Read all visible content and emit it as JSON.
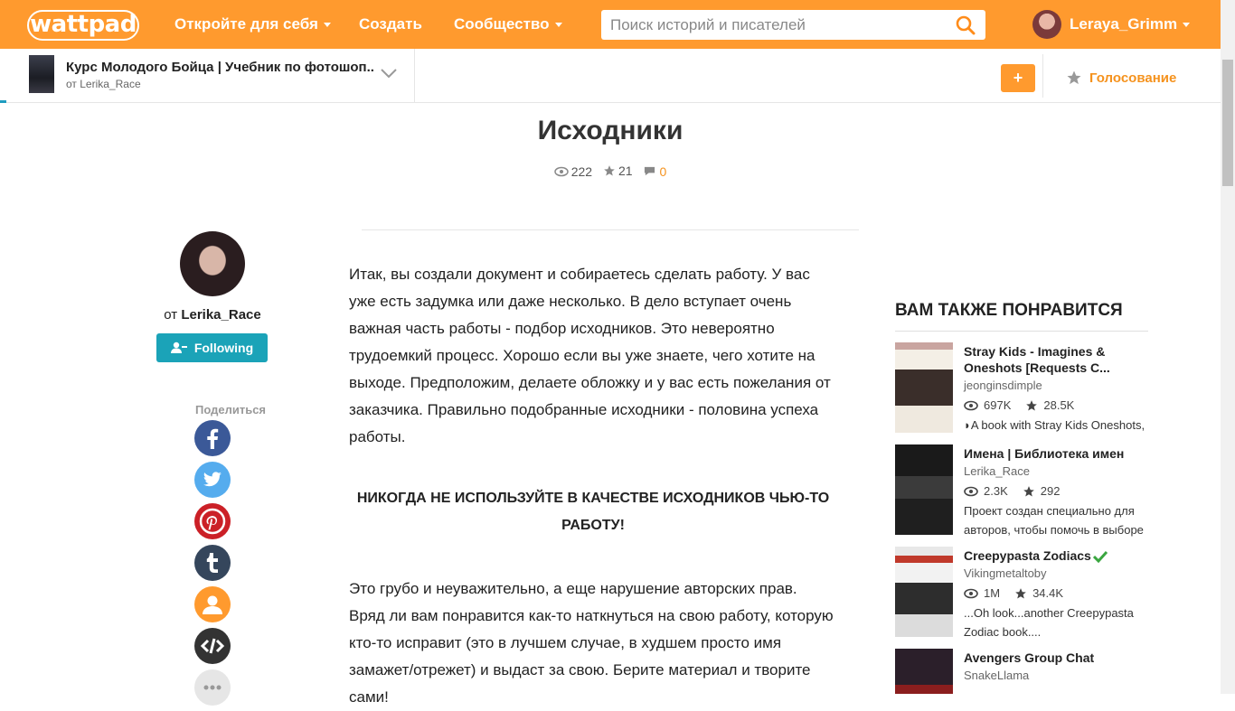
{
  "header": {
    "logo": "wattpad",
    "nav": [
      {
        "label": "Откройте для себя",
        "dropdown": true
      },
      {
        "label": "Создать",
        "dropdown": false
      },
      {
        "label": "Сообщество",
        "dropdown": true
      }
    ],
    "search_placeholder": "Поиск историй и писателей",
    "username": "Leraya_Grimm"
  },
  "storybar": {
    "title": "Курс Молодого Бойца | Учебник по фотошоп...",
    "author": "от Lerika_Race",
    "add_label": "+",
    "vote_label": "Голосование",
    "read_progress": 0.005
  },
  "chapter": {
    "title": "Исходники",
    "views": "222",
    "votes": "21",
    "comments": "0"
  },
  "author": {
    "by_prefix": "от",
    "name": "Lerika_Race",
    "follow_label": "Following",
    "share_label": "Поделиться"
  },
  "share_buttons": [
    {
      "name": "facebook",
      "color": "#3b5998"
    },
    {
      "name": "twitter",
      "color": "#55acee"
    },
    {
      "name": "pinterest",
      "color": "#cb2027"
    },
    {
      "name": "tumblr",
      "color": "#35465c"
    },
    {
      "name": "user",
      "color": "#ff9a2e"
    },
    {
      "name": "embed",
      "color": "#333333"
    },
    {
      "name": "more",
      "color": "#e6e6e6"
    }
  ],
  "article": {
    "p1": "Итак, вы создали документ и собираетесь сделать работу. У вас уже есть задумка или даже несколько. В дело вступает очень важная часть работы - подбор исходников. Это невероятно трудоемкий процесс. Хорошо если вы уже знаете, чего хотите на выходе. Предположим, делаете обложку и у вас есть пожелания от заказчика. Правильно подобранные исходники - половина успеха работы.",
    "p2": "НИКОГДА НЕ ИСПОЛЬЗУЙТЕ В КАЧЕСТВЕ ИСХОДНИКОВ ЧЬЮ-ТО РАБОТУ!",
    "p3": "Это грубо и неуважительно, а еще нарушение авторских прав. Вряд ли вам понравится как-то наткнуться на свою работу, которую кто-то исправит (это в лучшем случае, в худшем просто имя замажет/отрежет) и выдаст за свою. Берите материал и творите сами!"
  },
  "recommendations": {
    "heading": "ВАМ ТАКЖЕ ПОНРАВИТСЯ",
    "items": [
      {
        "title": "Stray Kids - Imagines & Oneshots [Requests C...",
        "author": "jeonginsdimple",
        "reads": "697K",
        "votes": "28.5K",
        "desc": "◗A book with Stray Kids Oneshots,"
      },
      {
        "title": "Имена | Библиотека имен",
        "author": "Lerika_Race",
        "reads": "2.3K",
        "votes": "292",
        "desc": "Проект создан специально для авторов, чтобы помочь в выборе"
      },
      {
        "title": "Creepypasta Zodiacs",
        "author": "Vikingmetaltoby",
        "reads": "1M",
        "votes": "34.4K",
        "desc": "...Oh look...another Creepypasta Zodiac book....",
        "verified": true
      },
      {
        "title": "Avengers Group Chat",
        "author": "SnakeLlama",
        "reads": "",
        "votes": "",
        "desc": ""
      }
    ]
  },
  "colors": {
    "brand": "#ff9a2e",
    "follow": "#1ba3b8",
    "progress": "#1f9cc0"
  }
}
